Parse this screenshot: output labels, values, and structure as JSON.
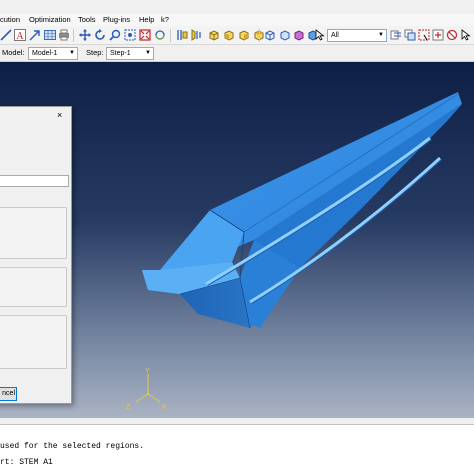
{
  "menu": {
    "items": [
      "cution",
      "Optimization",
      "Tools",
      "Plug-ins",
      "Help",
      "k?"
    ]
  },
  "toolbar": {
    "selection_filter": "All"
  },
  "context": {
    "model_label": "Model:",
    "model_value": "Model-1",
    "step_label": "Step:",
    "step_value": "Step-1"
  },
  "triad": {
    "y": "Y",
    "z": "Z",
    "x": "X"
  },
  "dialog": {
    "close": "×",
    "cancel_label": "ncel"
  },
  "messages": [
    "used for the selected regions.",
    "rt: STEM A1"
  ],
  "colors": {
    "part_blue": "#2a7fd6",
    "viewport_top": "#0e1f45",
    "viewport_bottom": "#a9b3c3",
    "triad_yellow": "#e8c94a"
  }
}
